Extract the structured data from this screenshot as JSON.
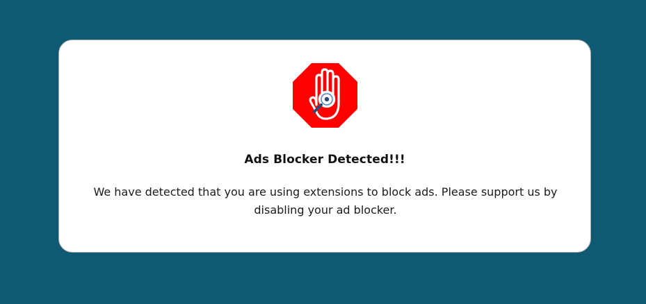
{
  "colors": {
    "overlay_background": "#0d5a72",
    "modal_background": "#ffffff",
    "stop_sign_red": "#ff0000",
    "stop_sign_border": "#ffffff",
    "hand_outline": "#ffffff",
    "magnifier_handle": "#2b4a7a"
  },
  "adblock_modal": {
    "icon": "stop-hand-magnifier-icon",
    "title": "Ads Blocker Detected!!!",
    "message": "We have detected that you are using extensions to block ads. Please support us by disabling your ad blocker."
  }
}
